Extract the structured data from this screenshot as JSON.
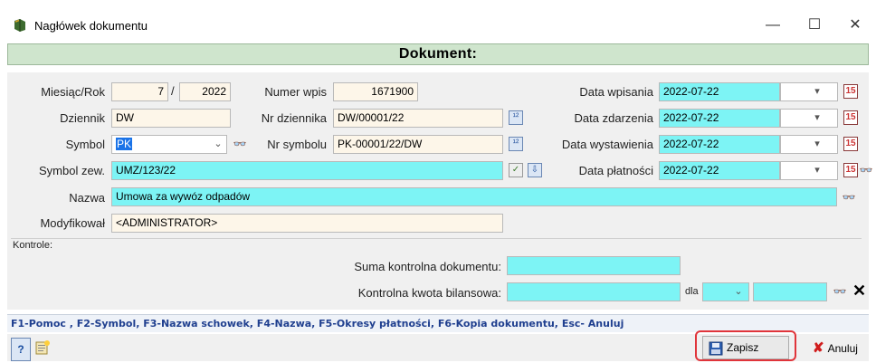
{
  "window": {
    "title": "Nagłówek dokumentu",
    "minimize": "—",
    "maximize": "☐",
    "close": "✕"
  },
  "header": {
    "title": "Dokument:"
  },
  "form": {
    "month_label": "Miesiąc/Rok",
    "month": "7",
    "slash": "/",
    "year": "2022",
    "entry_number_label": "Numer wpis",
    "entry_number": "1671900",
    "journal_label": "Dziennik",
    "journal": "DW",
    "journal_no_label": "Nr dziennika",
    "journal_no": "DW/00001/22",
    "symbol_label": "Symbol",
    "symbol": "PK",
    "symbol_no_label": "Nr symbolu",
    "symbol_no": "PK-00001/22/DW",
    "ext_symbol_label": "Symbol zew.",
    "ext_symbol": "UMZ/123/22",
    "name_label": "Nazwa",
    "name": "Umowa za wywóz odpadów",
    "modified_label": "Modyfikował",
    "modified": "<ADMINISTRATOR>",
    "entry_date_label": "Data wpisania",
    "entry_date": "2022-07-22",
    "event_date_label": "Data zdarzenia",
    "event_date": "2022-07-22",
    "issue_date_label": "Data wystawienia",
    "issue_date": "2022-07-22",
    "payment_date_label": "Data płatności",
    "payment_date": "2022-07-22"
  },
  "controls": {
    "section_label": "Kontrole:",
    "checksum_label": "Suma kontrolna dokumentu:",
    "checksum": "",
    "balance_label": "Kontrolna kwota bilansowa:",
    "balance": "",
    "for_label": "dla",
    "for_value": "",
    "for_amount": ""
  },
  "hint": "F1-Pomoc , F2-Symbol, F3-Nazwa schowek, F4-Nazwa, F5-Okresy płatności, F6-Kopia dokumentu, Esc- Anuluj",
  "buttons": {
    "help": "?",
    "save": "Zapisz",
    "cancel": "Anuluj"
  },
  "colors": {
    "highlight_ring": "#e0343a",
    "cyan_field": "#7df4f5",
    "cream_field": "#fdf6e9",
    "header_band": "#cfe5cd"
  },
  "icons": {
    "app": "book-icon",
    "calendar": "calendar-icon",
    "lookup": "binoculars-icon",
    "save": "floppy-icon",
    "cancel": "red-x-icon",
    "x_clear": "x-icon"
  }
}
